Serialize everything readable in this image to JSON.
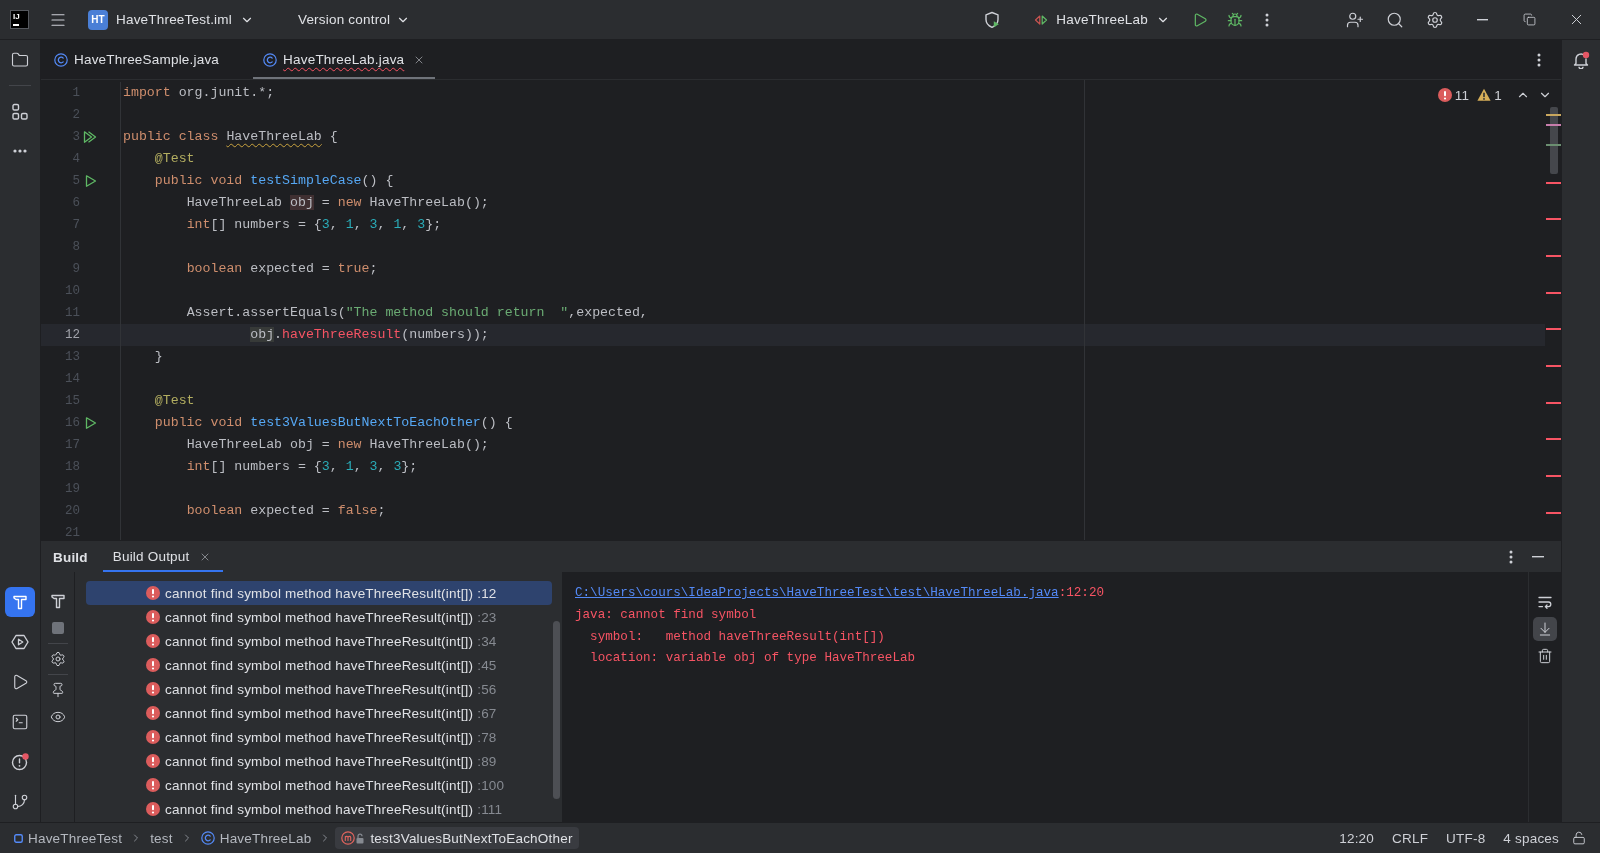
{
  "title_bar": {
    "logo": "IJ",
    "project_badge": "HT",
    "project": "HaveThreeTest.iml",
    "vcs": "Version control",
    "run_config": "HaveThreeLab"
  },
  "tool_strip": {
    "top": [
      {
        "kind": "project",
        "selected": false
      },
      {
        "kind": "structure",
        "selected": false
      },
      {
        "kind": "more",
        "selected": false
      }
    ],
    "bottom": [
      {
        "kind": "build",
        "selected": true
      },
      {
        "kind": "services",
        "selected": false
      },
      {
        "kind": "run",
        "selected": false
      },
      {
        "kind": "terminal",
        "selected": false
      },
      {
        "kind": "problems",
        "selected": false
      },
      {
        "kind": "git",
        "selected": false
      }
    ]
  },
  "editor_tabs": [
    {
      "label": "HaveThreeSample.java",
      "selected": false,
      "has_errors": false
    },
    {
      "label": "HaveThreeLab.java",
      "selected": true,
      "has_errors": true
    }
  ],
  "inspections": {
    "errors": "11",
    "warnings": "1"
  },
  "code_lines": [
    {
      "number": "1",
      "kind": "plain",
      "current": false,
      "tokens": [
        {
          "text": "import",
          "kind": "keyword"
        },
        {
          "text": " org.junit.*;",
          "kind": "plain"
        }
      ]
    },
    {
      "number": "2",
      "kind": "plain",
      "current": false
    },
    {
      "number": "3",
      "kind": "run-class",
      "current": false,
      "tokens": [
        {
          "text": "public class ",
          "kind": "keyword"
        },
        {
          "text": "HaveThreeLab",
          "kind": "warning"
        },
        {
          "text": " {",
          "kind": "plain"
        }
      ]
    },
    {
      "number": "4",
      "kind": "plain",
      "current": false,
      "tokens": [
        {
          "text": "    @Test",
          "kind": "annotation"
        }
      ]
    },
    {
      "number": "5",
      "kind": "run-method",
      "current": false,
      "tokens": [
        {
          "text": "    public void ",
          "kind": "keyword"
        },
        {
          "text": "testSimpleCase",
          "kind": "method"
        },
        {
          "text": "() {",
          "kind": "plain"
        }
      ]
    },
    {
      "number": "6",
      "kind": "plain",
      "current": false,
      "tokens": [
        {
          "text": "        HaveThreeLab ",
          "kind": "plain"
        },
        {
          "text": "obj",
          "kind": "var-write"
        },
        {
          "text": " = ",
          "kind": "plain"
        },
        {
          "text": "new",
          "kind": "keyword"
        },
        {
          "text": " HaveThreeLab();",
          "kind": "plain"
        }
      ]
    },
    {
      "number": "7",
      "kind": "plain",
      "current": false,
      "tokens": [
        {
          "text": "        int",
          "kind": "keyword"
        },
        {
          "text": "[] numbers = {",
          "kind": "plain"
        },
        {
          "text": "3",
          "kind": "number"
        },
        {
          "text": ", ",
          "kind": "plain"
        },
        {
          "text": "1",
          "kind": "number"
        },
        {
          "text": ", ",
          "kind": "plain"
        },
        {
          "text": "3",
          "kind": "number"
        },
        {
          "text": ", ",
          "kind": "plain"
        },
        {
          "text": "1",
          "kind": "number"
        },
        {
          "text": ", ",
          "kind": "plain"
        },
        {
          "text": "3",
          "kind": "number"
        },
        {
          "text": "};",
          "kind": "plain"
        }
      ]
    },
    {
      "number": "8",
      "kind": "plain",
      "current": false
    },
    {
      "number": "9",
      "kind": "plain",
      "current": false,
      "tokens": [
        {
          "text": "        boolean",
          "kind": "keyword"
        },
        {
          "text": " expected = ",
          "kind": "plain"
        },
        {
          "text": "true",
          "kind": "keyword"
        },
        {
          "text": ";",
          "kind": "plain"
        }
      ]
    },
    {
      "number": "10",
      "kind": "plain",
      "current": false
    },
    {
      "number": "11",
      "kind": "plain",
      "current": false,
      "tokens": [
        {
          "text": "        Assert.assertEquals(",
          "kind": "plain"
        },
        {
          "text": "\"The method should return  \"",
          "kind": "string"
        },
        {
          "text": ",expected,",
          "kind": "plain"
        }
      ]
    },
    {
      "number": "12",
      "kind": "plain",
      "current": true,
      "tokens": [
        {
          "text": "                obj",
          "kind": "var-read"
        },
        {
          "text": ".",
          "kind": "plain"
        },
        {
          "text": "haveThreeResult",
          "kind": "error"
        },
        {
          "text": "(numbers));",
          "kind": "plain"
        }
      ]
    },
    {
      "number": "13",
      "kind": "plain",
      "current": false,
      "tokens": [
        {
          "text": "    }",
          "kind": "plain"
        }
      ]
    },
    {
      "number": "14",
      "kind": "plain",
      "current": false
    },
    {
      "number": "15",
      "kind": "plain",
      "current": false,
      "tokens": [
        {
          "text": "    @Test",
          "kind": "annotation"
        }
      ]
    },
    {
      "number": "16",
      "kind": "run-method",
      "current": false,
      "tokens": [
        {
          "text": "    public void ",
          "kind": "keyword"
        },
        {
          "text": "test3ValuesButNextToEachOther",
          "kind": "method"
        },
        {
          "text": "() {",
          "kind": "plain"
        }
      ]
    },
    {
      "number": "17",
      "kind": "plain",
      "current": false,
      "tokens": [
        {
          "text": "        HaveThreeLab obj = ",
          "kind": "plain"
        },
        {
          "text": "new",
          "kind": "keyword"
        },
        {
          "text": " HaveThreeLab();",
          "kind": "plain"
        }
      ]
    },
    {
      "number": "18",
      "kind": "plain",
      "current": false,
      "tokens": [
        {
          "text": "        int",
          "kind": "keyword"
        },
        {
          "text": "[] numbers = {",
          "kind": "plain"
        },
        {
          "text": "3",
          "kind": "number"
        },
        {
          "text": ", ",
          "kind": "plain"
        },
        {
          "text": "1",
          "kind": "number"
        },
        {
          "text": ", ",
          "kind": "plain"
        },
        {
          "text": "3",
          "kind": "number"
        },
        {
          "text": ", ",
          "kind": "plain"
        },
        {
          "text": "3",
          "kind": "number"
        },
        {
          "text": "};",
          "kind": "plain"
        }
      ]
    },
    {
      "number": "19",
      "kind": "plain",
      "current": false
    },
    {
      "number": "20",
      "kind": "plain",
      "current": false,
      "tokens": [
        {
          "text": "        boolean",
          "kind": "keyword"
        },
        {
          "text": " expected = ",
          "kind": "plain"
        },
        {
          "text": "false",
          "kind": "keyword"
        },
        {
          "text": ";",
          "kind": "plain"
        }
      ]
    },
    {
      "number": "21",
      "kind": "plain",
      "current": false
    }
  ],
  "build_panel": {
    "title": "Build",
    "tabs": [
      {
        "label": "Build Output",
        "selected": true
      }
    ],
    "toolbar": [
      {
        "kind": "build",
        "disabled": false
      },
      {
        "kind": "stop",
        "disabled": true
      },
      {
        "kind": "settings",
        "disabled": false
      },
      {
        "kind": "pin",
        "disabled": false
      },
      {
        "kind": "view",
        "disabled": false
      }
    ],
    "messages": [
      {
        "text": "cannot find symbol method haveThreeResult(int[])",
        "location": ":12",
        "selected": true
      },
      {
        "text": "cannot find symbol method haveThreeResult(int[])",
        "location": ":23",
        "selected": false
      },
      {
        "text": "cannot find symbol method haveThreeResult(int[])",
        "location": ":34",
        "selected": false
      },
      {
        "text": "cannot find symbol method haveThreeResult(int[])",
        "location": ":45",
        "selected": false
      },
      {
        "text": "cannot find symbol method haveThreeResult(int[])",
        "location": ":56",
        "selected": false
      },
      {
        "text": "cannot find symbol method haveThreeResult(int[])",
        "location": ":67",
        "selected": false
      },
      {
        "text": "cannot find symbol method haveThreeResult(int[])",
        "location": ":78",
        "selected": false
      },
      {
        "text": "cannot find symbol method haveThreeResult(int[])",
        "location": ":89",
        "selected": false
      },
      {
        "text": "cannot find symbol method haveThreeResult(int[])",
        "location": ":100",
        "selected": false
      },
      {
        "text": "cannot find symbol method haveThreeResult(int[])",
        "location": ":111",
        "selected": false
      }
    ],
    "console": {
      "file_link": "C:\\Users\\cours\\IdeaProjects\\HaveThreeTest\\test\\HaveThreeLab.java",
      "position": ":12:20",
      "lines": [
        "java: cannot find symbol",
        "  symbol:   method haveThreeResult(int[])",
        "  location: variable obj of type HaveThreeLab"
      ]
    },
    "console_toolbar": [
      {
        "kind": "soft-wrap",
        "on": false
      },
      {
        "kind": "scroll-to-end",
        "on": true
      },
      {
        "kind": "clear",
        "on": false
      }
    ]
  },
  "status_bar": {
    "breadcrumbs": [
      {
        "label": "HaveThreeTest",
        "kind": "module",
        "selected": false
      },
      {
        "label": "test",
        "kind": "directory",
        "selected": false
      },
      {
        "label": "HaveThreeLab",
        "kind": "class",
        "selected": false
      },
      {
        "label": "test3ValuesButNextToEachOther",
        "kind": "method",
        "selected": true
      }
    ],
    "caret": "12:20",
    "line_separator": "CRLF",
    "encoding": "UTF-8",
    "indent": "4 spaces"
  }
}
